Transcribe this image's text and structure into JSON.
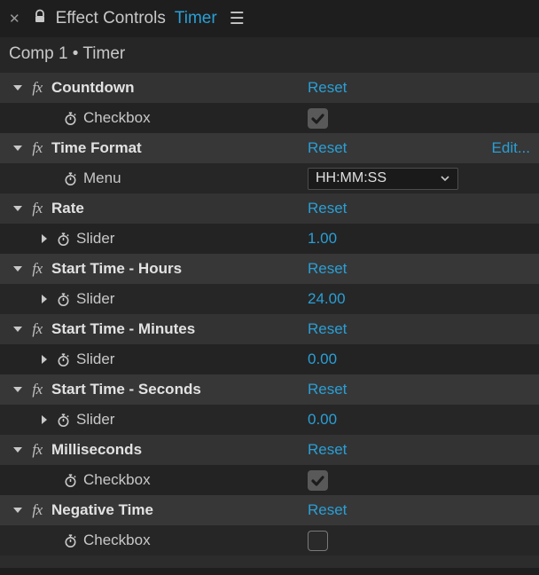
{
  "tab": {
    "title": "Effect Controls",
    "asset": "Timer"
  },
  "breadcrumb": "Comp 1 • Timer",
  "labels": {
    "reset": "Reset",
    "edit": "Edit..."
  },
  "controls": {
    "checkbox": "Checkbox",
    "menu": "Menu",
    "slider": "Slider"
  },
  "effects": [
    {
      "name": "Countdown",
      "param_type": "checkbox",
      "value_checked": true
    },
    {
      "name": "Time Format",
      "has_edit": true,
      "param_type": "menu",
      "value_select": "HH:MM:SS"
    },
    {
      "name": "Rate",
      "param_type": "slider",
      "value_text": "1.00"
    },
    {
      "name": "Start Time - Hours",
      "param_type": "slider",
      "value_text": "24.00"
    },
    {
      "name": "Start Time - Minutes",
      "param_type": "slider",
      "value_text": "0.00"
    },
    {
      "name": "Start Time - Seconds",
      "param_type": "slider",
      "value_text": "0.00"
    },
    {
      "name": "Milliseconds",
      "param_type": "checkbox",
      "value_checked": true
    },
    {
      "name": "Negative Time",
      "param_type": "checkbox",
      "value_checked": false
    }
  ]
}
